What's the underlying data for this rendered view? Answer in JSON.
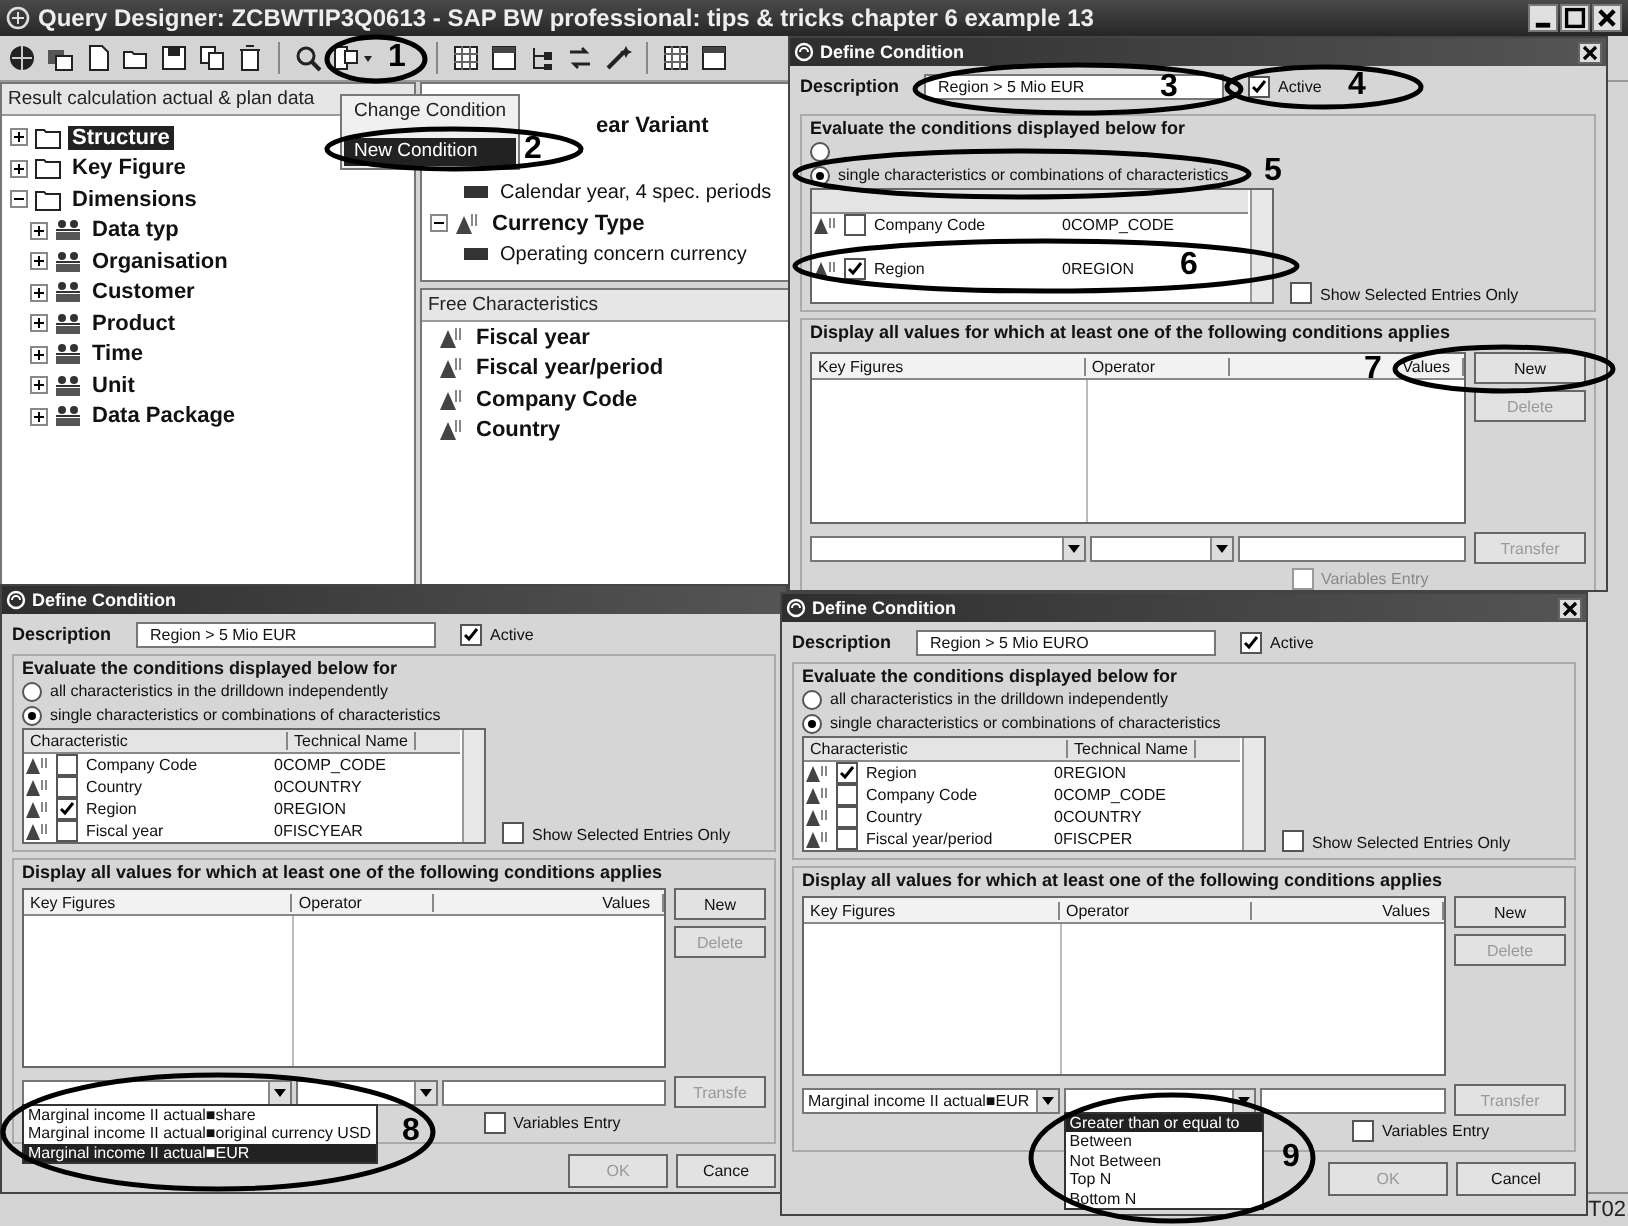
{
  "window": {
    "title": "Query Designer: ZCBWTIP3Q0613 - SAP BW professional: tips & tricks chapter 6 example 13"
  },
  "condition_menu": [
    {
      "label": "Change Condition",
      "selected": false
    },
    {
      "label": "New Condition",
      "selected": true
    }
  ],
  "query_tree": {
    "title": "Result calculation actual & plan data",
    "items": [
      {
        "label": "Structure",
        "kind": "folder",
        "selected": true,
        "expanded": false
      },
      {
        "label": "Key Figure",
        "kind": "folder",
        "selected": false,
        "expanded": false
      },
      {
        "label": "Dimensions",
        "kind": "folder",
        "selected": false,
        "expanded": true,
        "children": [
          {
            "label": "Data typ",
            "kind": "dimension",
            "selected": false,
            "expanded": false
          },
          {
            "label": "Organisation",
            "kind": "dimension",
            "selected": false,
            "expanded": false
          },
          {
            "label": "Customer",
            "kind": "dimension",
            "selected": false,
            "expanded": false
          },
          {
            "label": "Product",
            "kind": "dimension",
            "selected": false,
            "expanded": false
          },
          {
            "label": "Time",
            "kind": "dimension",
            "selected": false,
            "expanded": false
          },
          {
            "label": "Unit",
            "kind": "dimension",
            "selected": false,
            "expanded": false
          },
          {
            "label": "Data Package",
            "kind": "dimension",
            "selected": false,
            "expanded": false
          }
        ]
      }
    ]
  },
  "rows_pane": {
    "items": [
      {
        "label": "ear Variant",
        "kind": "partial",
        "children": [
          {
            "label": "Calendar year, 4 spec. periods",
            "kind": "value"
          }
        ]
      },
      {
        "label": "Currency Type",
        "kind": "characteristic",
        "expanded": true,
        "children": [
          {
            "label": "Operating concern currency",
            "kind": "value"
          }
        ]
      }
    ]
  },
  "free_characteristics": {
    "title": "Free Characteristics",
    "items": [
      {
        "label": "Fiscal year"
      },
      {
        "label": "Fiscal year/period"
      },
      {
        "label": "Company Code"
      },
      {
        "label": "Country"
      }
    ]
  },
  "dialogs": [
    {
      "title": "Define Condition",
      "close_button": true,
      "description_label": "Description",
      "description": "Region > 5 Mio EUR",
      "active_label": "Active",
      "active": true,
      "evaluate_heading": "Evaluate the conditions displayed below for",
      "scope_options": [
        {
          "selected": false
        },
        {
          "label": "single characteristics or combinations of characteristics",
          "selected": true
        }
      ],
      "characteristics": [
        {
          "name": "Company Code",
          "technical_name": "0COMP_CODE",
          "checked": false
        },
        {
          "kind": "obscured"
        },
        {
          "name": "Region",
          "technical_name": "0REGION",
          "checked": true
        },
        {
          "kind": "obscured"
        }
      ],
      "show_selected_label": "Show Selected Entries Only",
      "show_selected": false,
      "conditions_heading": "Display all values for which at least one of the following conditions applies",
      "condition_columns": [
        "Key Figures",
        "Operator",
        "Values"
      ],
      "variables_entry_label": "Variables Entry",
      "variables_entry": false,
      "variables_disabled": true,
      "buttons": [
        {
          "label": "New",
          "kind": "side",
          "disabled": false
        },
        {
          "label": "Delete",
          "kind": "side",
          "disabled": true
        },
        {
          "label": "Transfer",
          "kind": "transfer",
          "disabled": true
        }
      ]
    },
    {
      "title": "Define Condition",
      "close_button": false,
      "description_label": "Description",
      "description": "Region > 5 Mio EUR",
      "active_label": "Active",
      "active": true,
      "evaluate_heading": "Evaluate the conditions displayed below for",
      "scope_options": [
        {
          "label": "all characteristics in the drilldown independently",
          "selected": false
        },
        {
          "label": "single characteristics or combinations of characteristics",
          "selected": true
        }
      ],
      "characteristic_columns": [
        "Characteristic",
        "Technical Name"
      ],
      "characteristics": [
        {
          "name": "Company Code",
          "technical_name": "0COMP_CODE",
          "checked": false
        },
        {
          "name": "Country",
          "technical_name": "0COUNTRY",
          "checked": false
        },
        {
          "name": "Region",
          "technical_name": "0REGION",
          "checked": true
        },
        {
          "name": "Fiscal year",
          "technical_name": "0FISCYEAR",
          "checked": false
        }
      ],
      "show_selected_label": "Show Selected Entries Only",
      "show_selected": false,
      "conditions_heading": "Display all values for which at least one of the following conditions applies",
      "condition_columns": [
        "Key Figures",
        "Operator",
        "Values"
      ],
      "key_figure_options": [
        {
          "label": "Marginal income II actual■share",
          "selected": false
        },
        {
          "label": "Marginal income II actual■original currency USD",
          "selected": false
        },
        {
          "label": "Marginal income II actual■EUR",
          "selected": true
        }
      ],
      "variables_entry_label": "Variables Entry",
      "variables_entry": false,
      "variables_disabled": false,
      "buttons": [
        {
          "label": "New",
          "kind": "side",
          "disabled": false
        },
        {
          "label": "Delete",
          "kind": "side",
          "disabled": true
        },
        {
          "label": "Transfe",
          "kind": "transfer",
          "disabled": true
        },
        {
          "label": "OK",
          "kind": "footer",
          "disabled": true
        },
        {
          "label": "Cance",
          "kind": "footer",
          "disabled": false
        }
      ]
    },
    {
      "title": "Define Condition",
      "close_button": true,
      "description_label": "Description",
      "description": "Region > 5 Mio EURO",
      "active_label": "Active",
      "active": true,
      "evaluate_heading": "Evaluate the conditions displayed below for",
      "scope_options": [
        {
          "label": "all characteristics in the drilldown independently",
          "selected": false
        },
        {
          "label": "single characteristics or combinations of characteristics",
          "selected": true
        }
      ],
      "characteristic_columns": [
        "Characteristic",
        "Technical Name"
      ],
      "characteristics": [
        {
          "name": "Region",
          "technical_name": "0REGION",
          "checked": true
        },
        {
          "name": "Company Code",
          "technical_name": "0COMP_CODE",
          "checked": false
        },
        {
          "name": "Country",
          "technical_name": "0COUNTRY",
          "checked": false
        },
        {
          "name": "Fiscal year/period",
          "technical_name": "0FISCPER",
          "checked": false
        }
      ],
      "show_selected_label": "Show Selected Entries Only",
      "show_selected": false,
      "conditions_heading": "Display all values for which at least one of the following conditions applies",
      "condition_columns": [
        "Key Figures",
        "Operator",
        "Values"
      ],
      "key_figure": "Marginal income II actual■EUR",
      "operator_options": [
        {
          "label": "Greater than or equal to",
          "selected": true
        },
        {
          "label": "Between",
          "selected": false
        },
        {
          "label": "Not Between",
          "selected": false
        },
        {
          "label": "Top N",
          "selected": false
        },
        {
          "label": "Bottom N",
          "selected": false
        }
      ],
      "variables_entry_label": "Variables Entry",
      "variables_entry": false,
      "variables_disabled": false,
      "buttons": [
        {
          "label": "New",
          "kind": "side",
          "disabled": false
        },
        {
          "label": "Delete",
          "kind": "side",
          "disabled": true
        },
        {
          "label": "Transfer",
          "kind": "transfer",
          "disabled": true
        },
        {
          "label": "OK",
          "kind": "footer",
          "disabled": true
        },
        {
          "label": "Cancel",
          "kind": "footer",
          "disabled": false
        }
      ]
    }
  ],
  "callouts": [
    "1",
    "2",
    "3",
    "4",
    "5",
    "6",
    "7",
    "8",
    "9"
  ],
  "status_bar": {
    "text": "T02"
  }
}
